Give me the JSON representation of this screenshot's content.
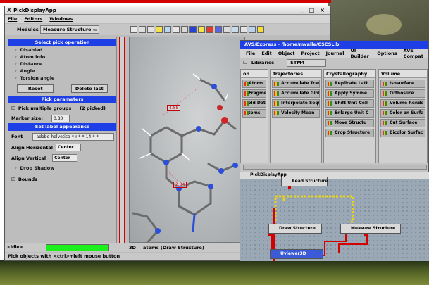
{
  "main_window": {
    "title": "PickDisplayApp",
    "controls": [
      "_",
      "□",
      "×"
    ],
    "menu": [
      "File",
      "Editors",
      "Windows"
    ]
  },
  "toolbar": {
    "modules_label": "Modules",
    "modules_value": "Measure Structure"
  },
  "pick_panel": {
    "section_title": "Select pick operation",
    "options": [
      "Disabled",
      "Atom info",
      "Distance",
      "Angle",
      "Torsion angle"
    ],
    "reset_label": "Reset",
    "delete_last_label": "Delete last",
    "params_title": "Pick parameters",
    "pick_multiple_label": "Pick multiple groups",
    "picked_count": "(2 picked)",
    "marker_size_label": "Marker size:",
    "marker_size_value": "0.80",
    "label_title": "Set label appearance",
    "font_label": "Font",
    "font_value": "-adobe-helvetica-*-r-*-*-14-*-*",
    "align_h_label": "Align Horizontal",
    "align_h_value": "Center",
    "align_v_label": "Align Vertical",
    "align_v_value": "Center",
    "drop_shadow_label": "Drop Shadow",
    "bounds_label": "Bounds"
  },
  "viewer": {
    "distances": [
      "4.88",
      "2.84"
    ]
  },
  "status": {
    "ellipsis": "<idle>",
    "viewer_number": "3D",
    "viewer_text": "atoms (Draw Structure)",
    "hint": "Pick objects with <ctrl>+left mouse button"
  },
  "express": {
    "title": "AVS/Express - /home/mvalle/CSCSLib",
    "menu": [
      "File",
      "Edit",
      "Object",
      "Project",
      "Journal",
      "UI Builder",
      "Options",
      "AVS Compat"
    ],
    "libraries_label": "Libraries",
    "library_value": "STM4",
    "columns": [
      {
        "title": "on",
        "items": [
          "t Atoms",
          "t Fragments",
          "hold Data",
          "Atoms"
        ]
      },
      {
        "title": "Trajectories",
        "items": [
          "Accumulate Trac",
          "Accumulate Glob",
          "Interpolate Seque",
          "Velocity Mean"
        ]
      },
      {
        "title": "Crystallography",
        "items": [
          "Replicate Latt",
          "Apply Symme",
          "Shift Unit Cell",
          "Enlarge Unit C",
          "Move Structu",
          "Crop Structure"
        ]
      },
      {
        "title": "Volume",
        "items": [
          "Isosurface",
          "Orthoslice",
          "Volume Rende",
          "Color on Surfa",
          "Cut Surface",
          "Bicolor Surfac"
        ]
      }
    ],
    "network_title": "PickDisplayApp",
    "nodes": {
      "read": "Read Structure",
      "draw": "Draw Structure",
      "measure": "Measure Structure",
      "viewer": "Uviewer3D"
    }
  },
  "colors": {
    "section_blue": "#1f3fe6",
    "status_green": "#1dee1d",
    "highlight_red": "#d40000"
  }
}
